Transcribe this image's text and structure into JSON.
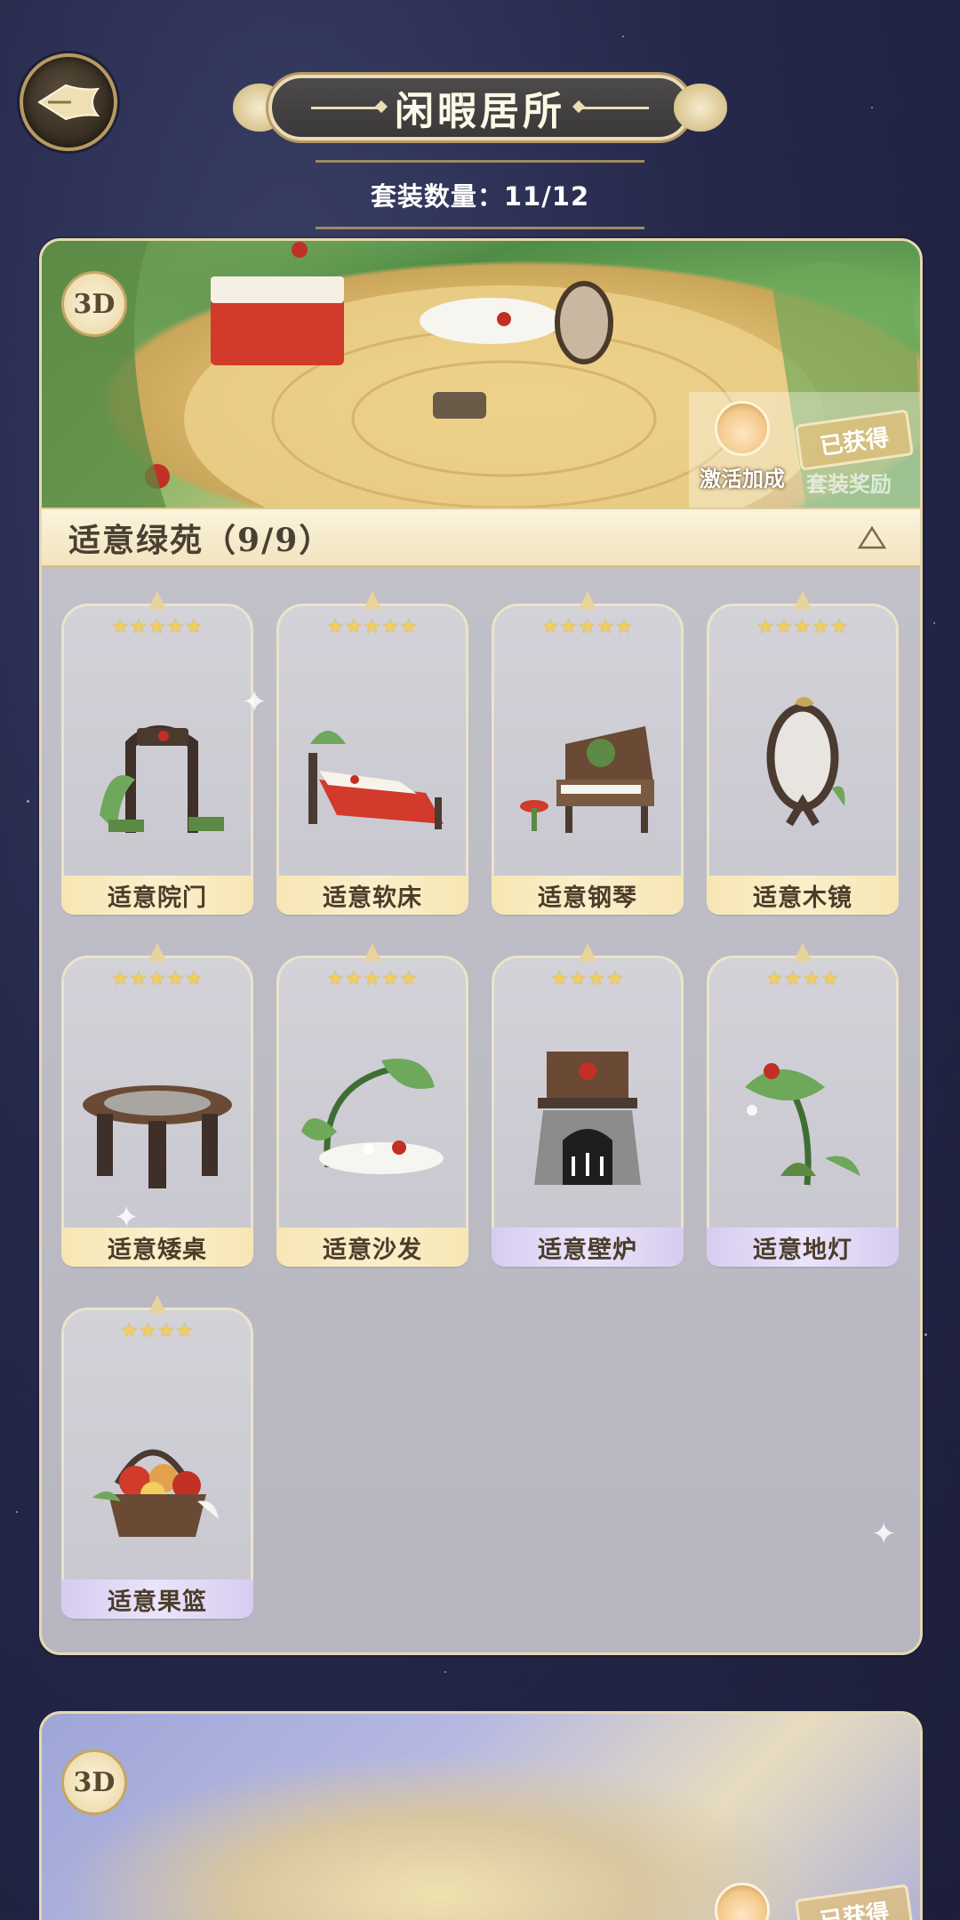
{
  "header": {
    "title": "闲暇居所",
    "set_count_text": "套装数量：11/12"
  },
  "sets": [
    {
      "badge": "3D",
      "activate_label": "激活加成",
      "obtained_label": "已获得",
      "reward_label": "套装奖励",
      "name": "适意绿苑（9/9）",
      "items": [
        {
          "name": "适意院门",
          "stars": "★★★★★",
          "rarity": "gold"
        },
        {
          "name": "适意软床",
          "stars": "★★★★★",
          "rarity": "gold"
        },
        {
          "name": "适意钢琴",
          "stars": "★★★★★",
          "rarity": "gold"
        },
        {
          "name": "适意木镜",
          "stars": "★★★★★",
          "rarity": "gold"
        },
        {
          "name": "适意矮桌",
          "stars": "★★★★★",
          "rarity": "gold"
        },
        {
          "name": "适意沙发",
          "stars": "★★★★★",
          "rarity": "gold"
        },
        {
          "name": "适意壁炉",
          "stars": "★★★★",
          "rarity": "purple"
        },
        {
          "name": "适意地灯",
          "stars": "★★★★",
          "rarity": "purple"
        },
        {
          "name": "适意果篮",
          "stars": "★★★★",
          "rarity": "purple"
        }
      ]
    },
    {
      "badge": "3D",
      "obtained_label": "已获得"
    }
  ]
}
